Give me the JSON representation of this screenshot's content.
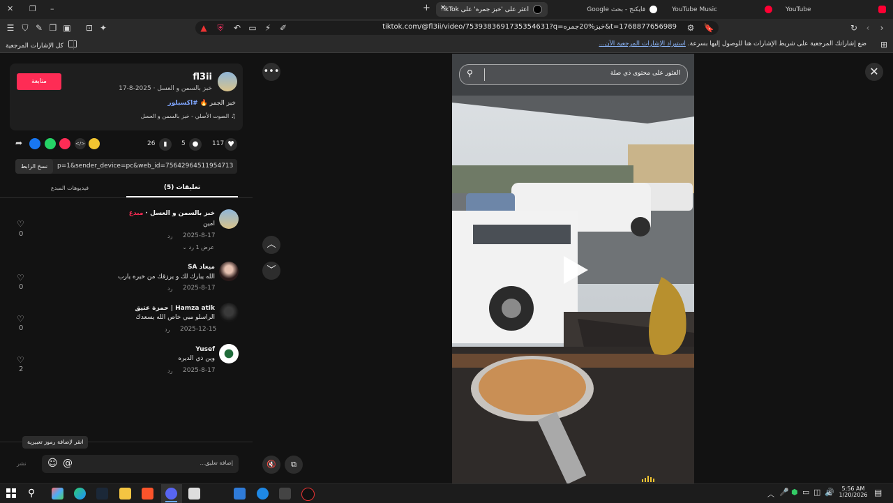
{
  "tabs": [
    {
      "label": "اعثر على 'خبز جمره' على TikTok",
      "active": true
    },
    {
      "label": "فايكنج - بحث Google",
      "active": false
    },
    {
      "label": "YouTube Music",
      "active": false
    },
    {
      "label": "YouTube",
      "active": false
    }
  ],
  "address": {
    "url": "tiktok.com/@fl3ii/video/7539383691735354631?q=خبز%20جمره&t=1768877656989"
  },
  "bookmarks": {
    "all_label": "كل الإشارات المرجعية",
    "hint": "ضع إشاراتك المرجعية على شريط الإشارات هنا للوصول إليها بسرعة.",
    "import_link": "استيراد الإشارات المرجعية الآن..."
  },
  "post": {
    "username": "fl3ii",
    "subtitle": "خبز بالسمن و العسل · 2025-8-17",
    "follow_label": "متابعة",
    "caption_text": "خبز الجمر",
    "caption_tag": "#اكسبلور",
    "sound": "الصوت الأصلي - خبز بالسمن و العسل",
    "likes": "117",
    "comments": "5",
    "saves": "26",
    "link": "p=1&sender_device=pc&web_id=7564296451195471380...",
    "copy_label": "نسخ الرابط"
  },
  "tabs_panel": {
    "comments_tab": "تعليقات (5)",
    "creator_tab": "فيديوهات المبدع"
  },
  "comments": [
    {
      "name": "خبز بالسمن و العسل",
      "badge": "مبدع",
      "text": "امين",
      "date": "2025-8-17",
      "reply": "رد",
      "likes": "0",
      "view_replies": "عرض 1 رد"
    },
    {
      "name": "ميعاد SA",
      "text": "الله يبارك لك و يرزقك من خيره يارب",
      "date": "2025-8-17",
      "reply": "رد",
      "likes": "0"
    },
    {
      "name": "Hamza atik | حمزة عتيق",
      "text": "الراسلو مبي خاص الله يسعدك",
      "date": "2025-12-15",
      "reply": "رد",
      "likes": "0"
    },
    {
      "name": "Yusef",
      "text": "وين ذي الديره",
      "date": "2025-8-17",
      "reply": "رد",
      "likes": "2"
    }
  ],
  "composer": {
    "tooltip": "انقر لإضافة رموز تعبيرية",
    "placeholder": "إضافة تعليق...",
    "post_label": "نشر"
  },
  "video": {
    "search_placeholder": "العثور على محتوى ذي صلة"
  },
  "taskbar": {
    "time": "5:56 AM",
    "date": "1/20/2026",
    "lang": "ع"
  },
  "colors": {
    "accent": "#fe2c55",
    "link": "#7fa6ff"
  }
}
